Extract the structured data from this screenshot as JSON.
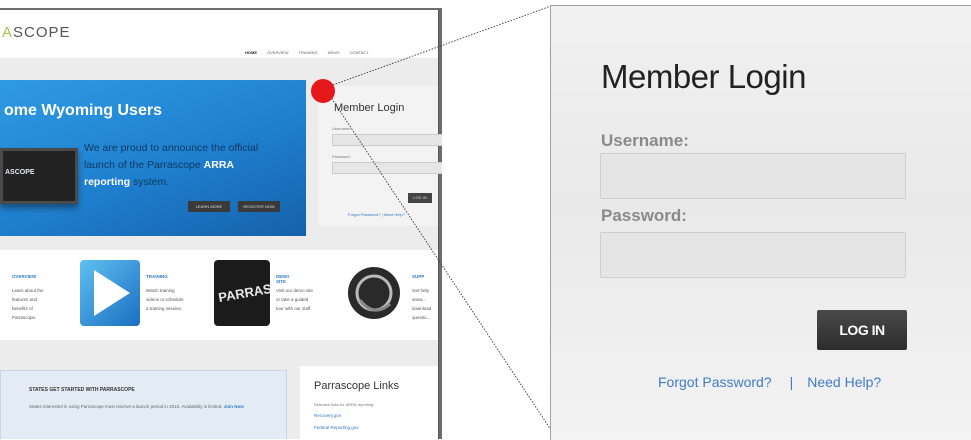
{
  "thumbnail": {
    "logo": {
      "accent": "A",
      "rest": "SCOPE"
    },
    "nav": [
      "Home",
      "Overview",
      "Training",
      "News",
      "Contact"
    ],
    "hero": {
      "title": "ome Wyoming Users",
      "text_before": "We are proud to announce the official launch of the Parrascope",
      "text_highlight": "ARRA reporting",
      "text_after": "system.",
      "tv_label": "ASCOPE",
      "buttons": [
        "Learn More",
        "Register Now"
      ]
    },
    "mini_login": {
      "title": "Member Login",
      "username_label": "Username:",
      "password_label": "Password:",
      "button": "LOG IN",
      "links": "Forgot Password?  |  Need Help?"
    },
    "features": [
      {
        "title": "Overview",
        "text": "Learn about the features and benefits of Parrascope.",
        "icon": "monitor-icon"
      },
      {
        "title": "Training",
        "text": "Watch training videos or schedule a training session.",
        "icon": "play-icon"
      },
      {
        "title": "Demo Site",
        "text": "Visit our demo site or take a guided tour with our staff.",
        "icon": "parrascope-badge-icon"
      },
      {
        "title": "Supp",
        "text": "Get help answ... download questio...",
        "icon": "headset-icon"
      }
    ],
    "states_box": {
      "title": "States get started with Parrascope",
      "text": "States interested in using Parrascope must reserve a launch period in 2010. Availability is limited.",
      "join": "Join Now"
    },
    "links_box": {
      "title": "Parrascope Links",
      "subtitle": "Relevant links for ARRA reporting",
      "items": [
        "Recovery.gov",
        "Federal Reporting.gov"
      ]
    }
  },
  "login_zoom": {
    "title": "Member Login",
    "username_label": "Username:",
    "username_value": "",
    "password_label": "Password:",
    "password_value": "",
    "login_button": "LOG IN",
    "forgot_password": "Forgot Password?",
    "separator": "|",
    "need_help": "Need Help?"
  },
  "colors": {
    "pointer_dot": "#e5181b",
    "hero_blue": "#1f7fcf",
    "link_blue": "#3f7cc7",
    "button_dark": "#333333"
  }
}
